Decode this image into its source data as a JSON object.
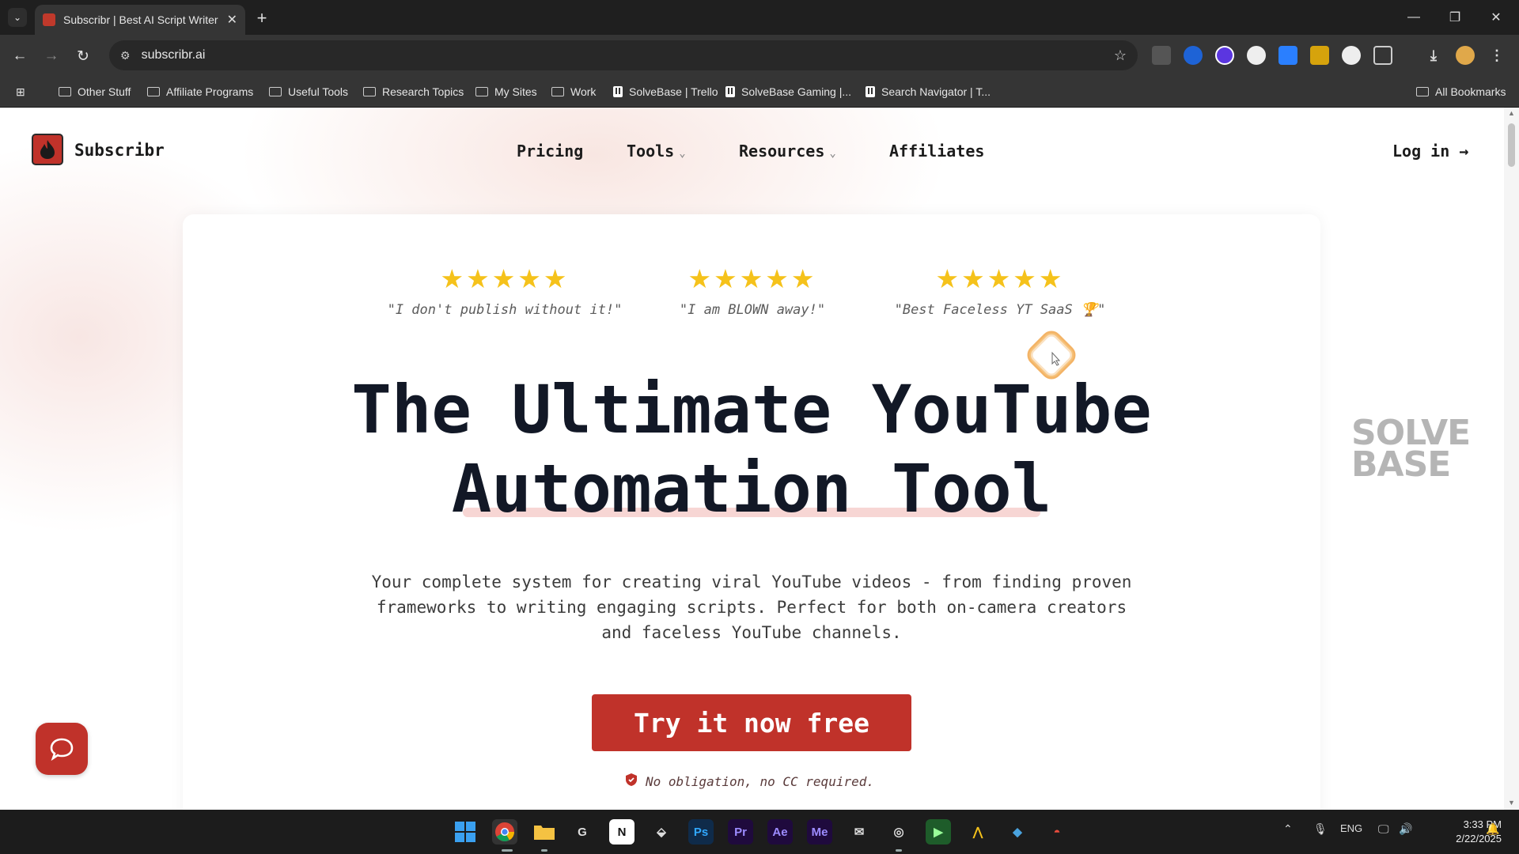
{
  "browser": {
    "tab_title": "Subscribr | Best AI Script Writer",
    "url": "subscribr.ai",
    "bookmarks": [
      {
        "label": "Other Stuff",
        "kind": "folder"
      },
      {
        "label": "Affiliate Programs",
        "kind": "folder"
      },
      {
        "label": "Useful Tools",
        "kind": "folder"
      },
      {
        "label": "Research Topics",
        "kind": "folder"
      },
      {
        "label": "My Sites",
        "kind": "folder"
      },
      {
        "label": "Work",
        "kind": "folder"
      },
      {
        "label": "SolveBase | Trello",
        "kind": "trello"
      },
      {
        "label": "SolveBase Gaming |...",
        "kind": "trello"
      },
      {
        "label": "Search Navigator | T...",
        "kind": "trello"
      }
    ],
    "all_bookmarks_label": "All Bookmarks"
  },
  "site": {
    "brand": "Subscribr",
    "nav": {
      "pricing": "Pricing",
      "tools": "Tools",
      "resources": "Resources",
      "affiliates": "Affiliates",
      "login": "Log in →"
    },
    "reviews": [
      {
        "stars": "★★★★★",
        "rating": 5,
        "quote": "\"I don't publish without it!\""
      },
      {
        "stars": "★★★★★",
        "rating": 5,
        "quote": "\"I am BLOWN away!\""
      },
      {
        "stars": "★★★★★",
        "rating": 5,
        "quote": "\"Best Faceless YT SaaS 🏆\""
      }
    ],
    "headline_line1": "The Ultimate YouTube",
    "headline_line2": "Automation Tool",
    "subtext": "Your complete system for creating viral YouTube videos - from finding proven frameworks to writing engaging scripts. Perfect for both on-camera creators and faceless YouTube channels.",
    "cta_label": "Try it now free",
    "cta_note": "No obligation, no CC required.",
    "accent_color": "#c0322a",
    "star_color": "#f5c21b"
  },
  "watermark": {
    "line1": "SOLVE",
    "line2": "BASE"
  },
  "taskbar": {
    "apps": [
      "Ps",
      "Pr",
      "Ae",
      "Me"
    ],
    "lang": "ENG",
    "time": "3:33 PM",
    "date": "2/22/2025"
  }
}
